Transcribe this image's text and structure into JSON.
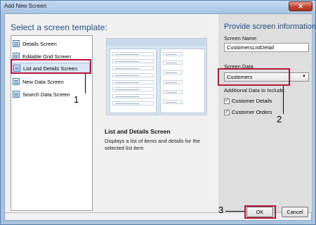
{
  "window": {
    "title": "Add New Screen",
    "close_glyph": "✕"
  },
  "left": {
    "heading": "Select a screen template:",
    "templates": [
      {
        "label": "Details Screen",
        "icon": "screen-template-icon"
      },
      {
        "label": "Editable Grid Screen",
        "icon": "screen-template-icon"
      },
      {
        "label": "List and Details Screen",
        "icon": "screen-template-icon",
        "selected": true
      },
      {
        "label": "New Data Screen",
        "icon": "screen-template-icon"
      },
      {
        "label": "Search Data Screen",
        "icon": "screen-template-icon"
      }
    ]
  },
  "preview": {
    "title": "List and Details Screen",
    "description": "Displays a list of items and details for the selected list item"
  },
  "right": {
    "heading": "Provide screen information:",
    "screen_name_label": "Screen Name:",
    "screen_name_value": "CustomersListDetail",
    "screen_data_label": "Screen Data",
    "screen_data_value": "Customers",
    "additional_label": "Additional Data to Include:",
    "checkboxes": [
      {
        "label": "Customer Details",
        "checked": true
      },
      {
        "label": "Customer Orders",
        "checked": true
      }
    ]
  },
  "callouts": {
    "one": "1",
    "two": "2",
    "three": "3"
  },
  "buttons": {
    "ok": "OK",
    "cancel": "Cancel"
  },
  "colors": {
    "highlight": "#b3173a",
    "heading": "#1e4f8a"
  }
}
